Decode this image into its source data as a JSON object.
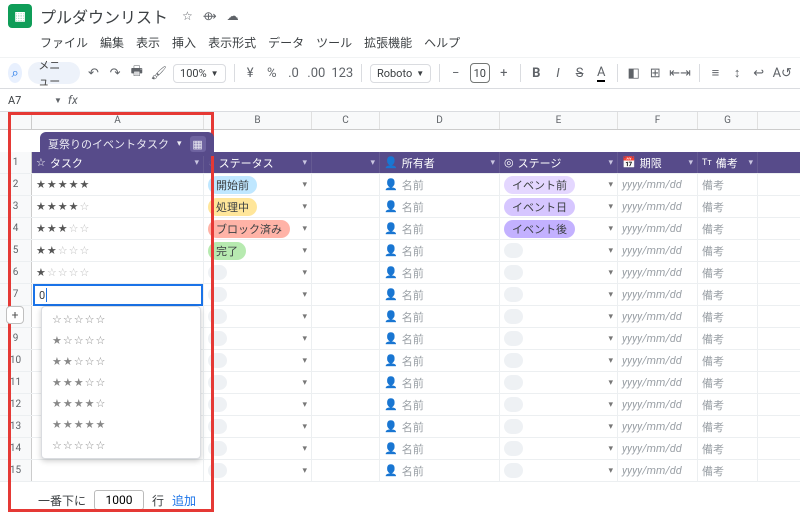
{
  "header": {
    "doc_title": "プルダウンリスト"
  },
  "menubar": [
    "ファイル",
    "編集",
    "表示",
    "挿入",
    "表示形式",
    "データ",
    "ツール",
    "拡張機能",
    "ヘルプ"
  ],
  "toolbar": {
    "menu_label": "メニュー",
    "zoom": "100%",
    "font": "Roboto",
    "size": "10",
    "currency": "¥",
    "percent": "%",
    "number_fmt": "123"
  },
  "namebox": {
    "cell": "A7",
    "fx": "fx"
  },
  "columns": [
    "A",
    "B",
    "C",
    "D",
    "E",
    "F",
    "G"
  ],
  "table": {
    "chip_label": "夏祭りのイベントタスク",
    "headers": {
      "task": "タスク",
      "status": "ステータス",
      "owner": "所有者",
      "stage": "ステージ",
      "due": "期限",
      "note": "備考"
    },
    "owner_placeholder": "名前",
    "date_placeholder": "yyyy/mm/dd",
    "note_placeholder": "備考",
    "active_value": "0",
    "rows": [
      {
        "n": 2,
        "stars": 5,
        "status": {
          "label": "開始前",
          "bg": "#bfe7ff"
        },
        "stage": {
          "label": "イベント前",
          "bg": "#e4d7ff"
        }
      },
      {
        "n": 3,
        "stars": 4,
        "status": {
          "label": "処理中",
          "bg": "#ffe69a"
        },
        "stage": {
          "label": "イベント日",
          "bg": "#d6c6ff"
        }
      },
      {
        "n": 4,
        "stars": 3,
        "status": {
          "label": "ブロック済み",
          "bg": "#ffb3a7"
        },
        "stage": {
          "label": "イベント後",
          "bg": "#c3b1ff"
        }
      },
      {
        "n": 5,
        "stars": 2,
        "status": {
          "label": "完了",
          "bg": "#b7eab0"
        }
      },
      {
        "n": 6,
        "stars": 1
      },
      {
        "n": 7
      },
      {
        "n": 8
      },
      {
        "n": 9
      },
      {
        "n": 10
      },
      {
        "n": 11
      },
      {
        "n": 12
      },
      {
        "n": 13
      },
      {
        "n": 14
      },
      {
        "n": 15
      }
    ],
    "dropdown_options": [
      "☆☆☆☆☆",
      "★☆☆☆☆",
      "★★☆☆☆",
      "★★★☆☆",
      "★★★★☆",
      "★★★★★",
      "☆☆☆☆☆"
    ]
  },
  "footer": {
    "prefix": "一番下に",
    "value": "1000",
    "suffix": "行",
    "add": "追加"
  }
}
